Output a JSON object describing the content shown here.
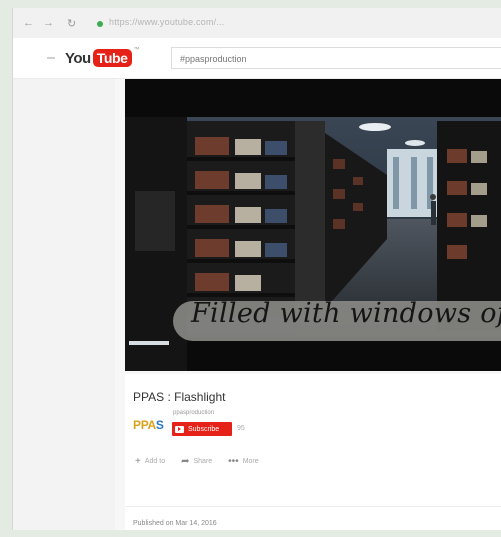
{
  "browser": {
    "back": "←",
    "forward": "→",
    "reload": "↻",
    "url": "https://www.youtube.com/..."
  },
  "header": {
    "logo_you": "You",
    "logo_tube": "Tube",
    "logo_mark": "™",
    "search_value": "#ppasproduction"
  },
  "video": {
    "caption": "Filled with windows of l",
    "title": "PPAS : Flashlight",
    "channel_name": "ppasproduction",
    "channel_logo_p": "PPA",
    "channel_logo_s": "S",
    "subscribe_label": "Subscribe",
    "subscriber_count": "95"
  },
  "actions": [
    {
      "icon": "+",
      "label": "Add to"
    },
    {
      "icon": "➦",
      "label": "Share"
    },
    {
      "icon": "•••",
      "label": "More"
    }
  ],
  "description": {
    "published": "Published on Mar 14, 2016"
  }
}
